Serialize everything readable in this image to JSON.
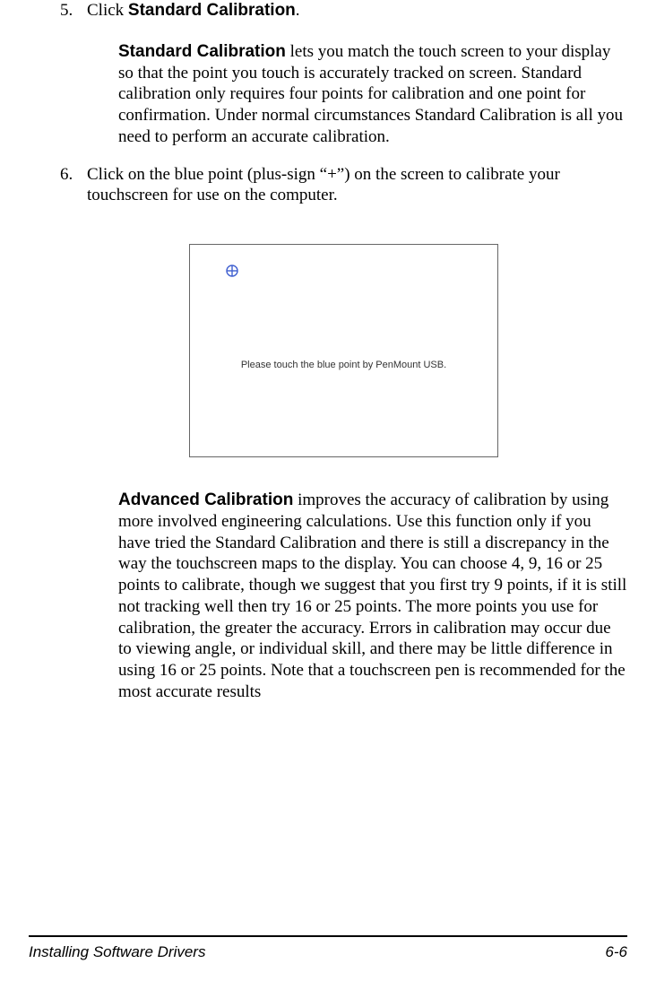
{
  "step5": {
    "num": "5.",
    "line": "Click ",
    "boldTerm": "Standard Calibration",
    "period": "."
  },
  "step5_para": {
    "bold": "Standard Calibration",
    "rest": " lets you match the touch screen to your display so that the point you touch is accurately tracked on screen. Standard calibration only requires four points for calibration and one point for confirmation. Under normal circumstances Standard Calibration is all you need to perform an accurate calibration."
  },
  "step6": {
    "num": "6.",
    "text": "Click on the blue point (plus-sign “+”) on the screen to calibrate your touchscreen for use on the computer."
  },
  "figure": {
    "plus": "⊕",
    "caption": "Please touch the blue point by PenMount USB."
  },
  "advanced": {
    "bold": "Advanced Calibration",
    "rest": " improves the accuracy of calibration by using more involved engineering calculations. Use this function only if you have tried the Standard Calibration and there is still a discrepancy in the way the touchscreen maps to the display. You can choose 4, 9, 16 or 25 points to calibrate, though we suggest that you first try 9 points, if it is still not tracking well then try 16 or 25 points. The more points you use for calibration, the greater the accuracy. Errors in calibration may occur due to viewing angle, or individual skill, and there may be little difference in using 16 or 25 points. Note that a touchscreen pen is recommended for the most accurate results"
  },
  "footer": {
    "left": "Installing Software Drivers",
    "right": "6-6"
  }
}
